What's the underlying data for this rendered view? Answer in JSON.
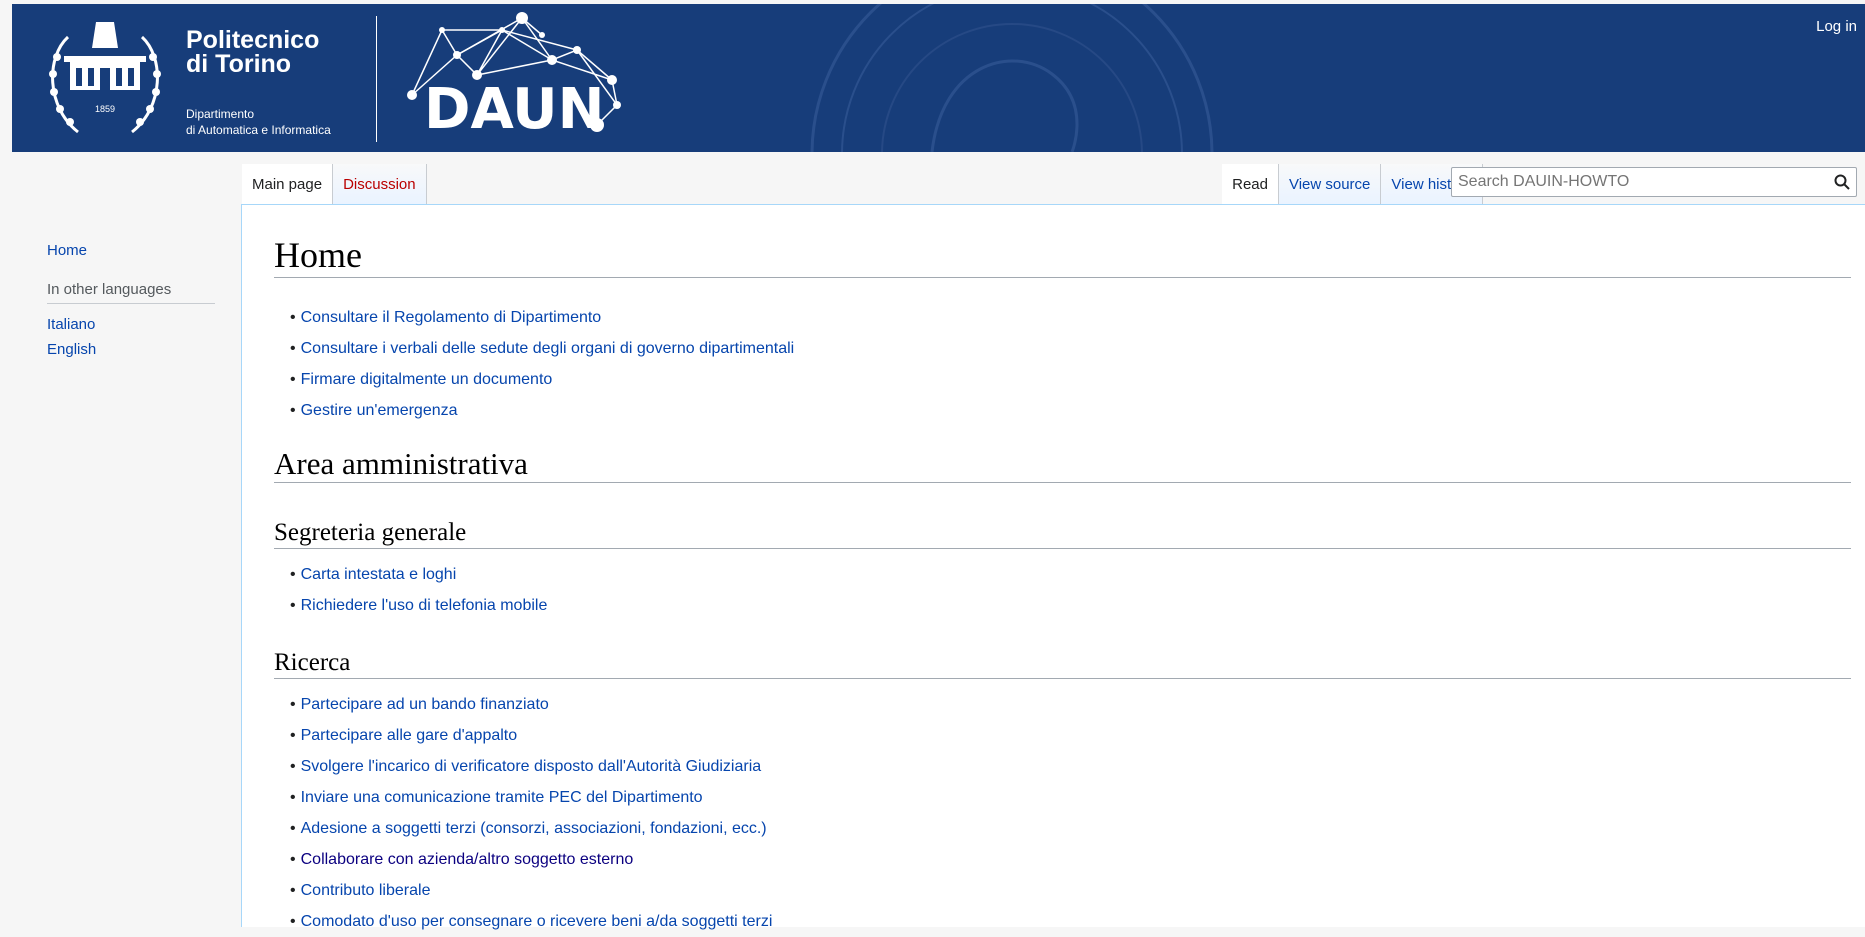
{
  "header": {
    "login": "Log in",
    "logo_line1": "Politecnico",
    "logo_line2": "di Torino",
    "logo_sub1": "Dipartimento",
    "logo_sub2": "di Automatica e Informatica",
    "emblem_year": "1859",
    "daun_text": "DAUN"
  },
  "tabs": {
    "main_page": "Main page",
    "discussion": "Discussion",
    "read": "Read",
    "view_source": "View source",
    "view_history": "View history"
  },
  "search": {
    "placeholder": "Search DAUIN-HOWTO",
    "icon": "search-icon"
  },
  "sidebar": {
    "home": "Home",
    "languages_heading": "In other languages",
    "languages": [
      "Italiano",
      "English"
    ]
  },
  "page": {
    "title": "Home",
    "intro_links": [
      "Consultare il Regolamento di Dipartimento",
      "Consultare i verbali delle sedute degli organi di governo dipartimentali",
      "Firmare digitalmente un documento",
      "Gestire un'emergenza"
    ],
    "section1": "Area amministrativa",
    "sub1": "Segreteria generale",
    "sub1_links": [
      "Carta intestata e loghi",
      "Richiedere l'uso di telefonia mobile"
    ],
    "sub2": "Ricerca",
    "sub2_links": [
      "Partecipare ad un bando finanziato",
      "Partecipare alle gare d'appalto",
      "Svolgere l'incarico di verificatore disposto dall'Autorità Giudiziaria",
      "Inviare una comunicazione tramite PEC del Dipartimento",
      "Adesione a soggetti terzi (consorzi, associazioni, fondazioni, ecc.)",
      "Collaborare con azienda/altro soggetto esterno",
      "Contributo liberale",
      "Comodato d'uso per consegnare o ricevere beni a/da soggetti terzi"
    ]
  },
  "colors": {
    "header_bg": "#173d7a",
    "link": "#0645ad",
    "visited_link": "#0b0080",
    "redlink": "#ba0000"
  }
}
